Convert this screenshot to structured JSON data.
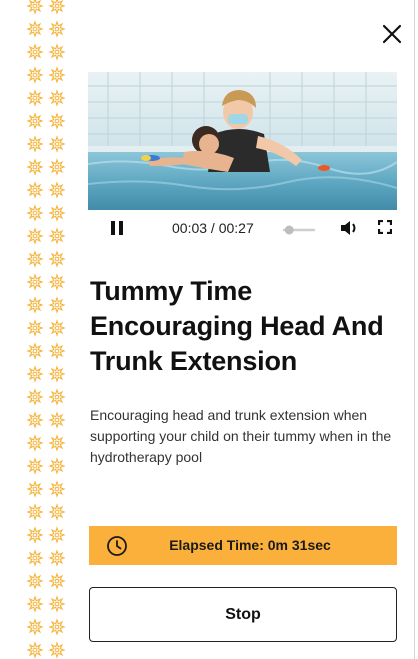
{
  "colors": {
    "accent": "#fbb03b",
    "pattern": "#f5b43d",
    "text": "#111111",
    "water": "#9fd2e6"
  },
  "header": {
    "close_icon": "close-icon"
  },
  "video": {
    "current_time": "00:03",
    "duration": "00:27",
    "time_display": "00:03 / 00:27",
    "progress": 0.11,
    "icons": [
      "pause-icon",
      "volume-icon",
      "fullscreen-icon"
    ]
  },
  "content": {
    "title": "Tummy Time Encouraging Head And Trunk Extension",
    "description": "Encouraging head and trunk extension when supporting your child on their tummy when in the hydrotherapy pool"
  },
  "timer": {
    "label": "Elapsed Time: 0m 31sec",
    "icon": "clock-icon"
  },
  "actions": {
    "stop_label": "Stop"
  }
}
